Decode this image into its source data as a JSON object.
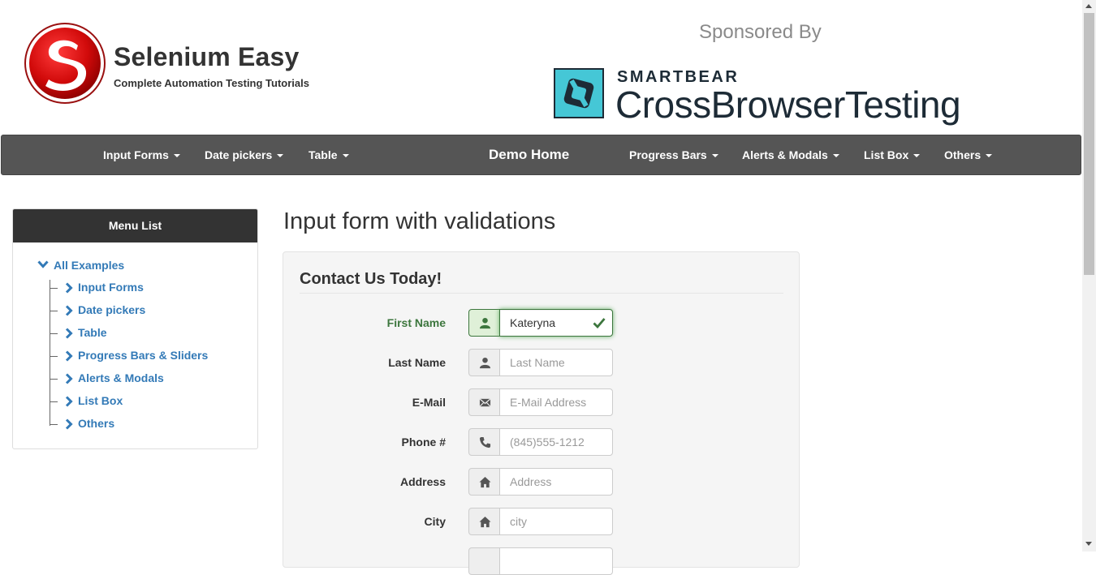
{
  "header": {
    "site_title": "Selenium Easy",
    "site_tagline": "Complete Automation Testing Tutorials",
    "sponsored_by": "Sponsored By",
    "sponsor_brand": "SMARTBEAR",
    "sponsor_product": "CrossBrowserTesting",
    "logo_icon": "selenium-easy-logo",
    "sponsor_icon": "smartbear-logo"
  },
  "navbar": {
    "items_left": [
      "Input Forms",
      "Date pickers",
      "Table"
    ],
    "home": "Demo Home",
    "items_right": [
      "Progress Bars",
      "Alerts & Modals",
      "List Box",
      "Others"
    ]
  },
  "sidebar": {
    "title": "Menu List",
    "root": "All Examples",
    "items": [
      "Input Forms",
      "Date pickers",
      "Table",
      "Progress Bars & Sliders",
      "Alerts & Modals",
      "List Box",
      "Others"
    ]
  },
  "main": {
    "title": "Input form with validations",
    "legend": "Contact Us Today!",
    "fields": [
      {
        "label": "First Name",
        "value": "Kateryna",
        "placeholder": "",
        "icon": "user-icon",
        "state": "success"
      },
      {
        "label": "Last Name",
        "value": "",
        "placeholder": "Last Name",
        "icon": "user-icon",
        "state": ""
      },
      {
        "label": "E-Mail",
        "value": "",
        "placeholder": "E-Mail Address",
        "icon": "envelope-icon",
        "state": ""
      },
      {
        "label": "Phone #",
        "value": "",
        "placeholder": "(845)555-1212",
        "icon": "phone-icon",
        "state": ""
      },
      {
        "label": "Address",
        "value": "",
        "placeholder": "Address",
        "icon": "home-icon",
        "state": ""
      },
      {
        "label": "City",
        "value": "",
        "placeholder": "city",
        "icon": "home-icon",
        "state": ""
      }
    ]
  },
  "colors": {
    "navbar_bg": "#555555",
    "link": "#337ab7",
    "success": "#3c763d",
    "success_bg": "#dff0d8"
  }
}
